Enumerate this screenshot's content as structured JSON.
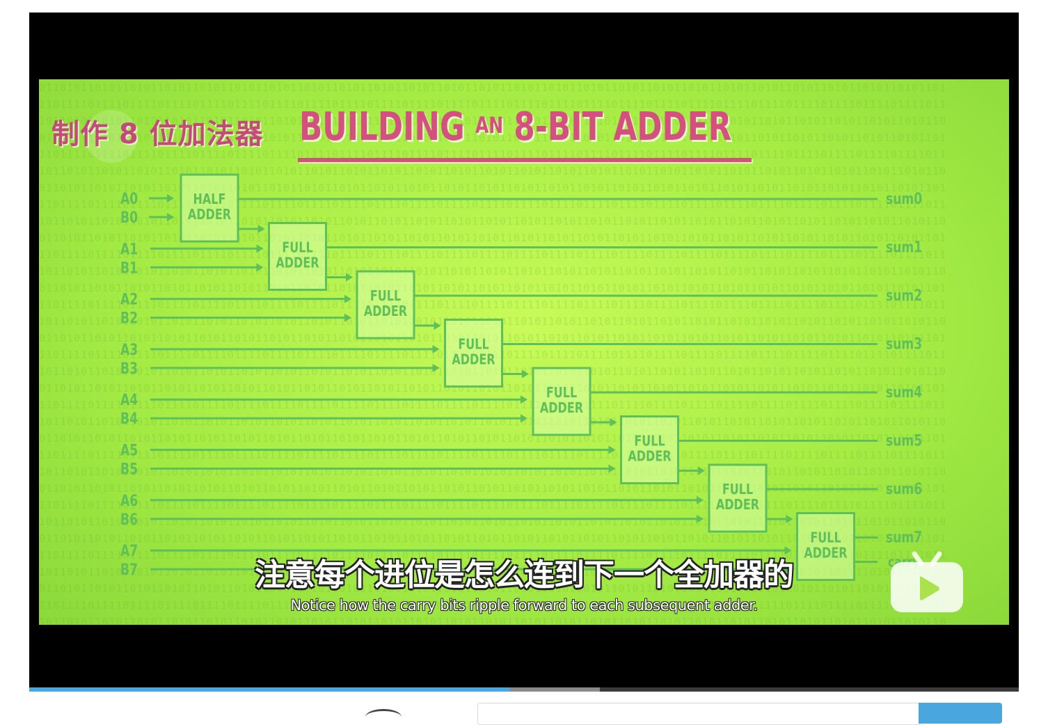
{
  "video": {
    "title_cn": "制作 8 位加法器",
    "title_en_main": "BUILDING",
    "title_en_small": "AN",
    "title_en_rest": "8-BIT ADDER",
    "subtitle_cn": "注意每个进位是怎么连到下一个全加器的",
    "subtitle_en": "Notice how the carry bits ripple forward to each subsequent adder."
  },
  "diagram": {
    "inputs": [
      {
        "a": "A0",
        "b": "B0"
      },
      {
        "a": "A1",
        "b": "B1"
      },
      {
        "a": "A2",
        "b": "B2"
      },
      {
        "a": "A3",
        "b": "B3"
      },
      {
        "a": "A4",
        "b": "B4"
      },
      {
        "a": "A5",
        "b": "B5"
      },
      {
        "a": "A6",
        "b": "B6"
      },
      {
        "a": "A7",
        "b": "B7"
      }
    ],
    "adders": [
      {
        "line1": "HALF",
        "line2": "ADDER"
      },
      {
        "line1": "FULL",
        "line2": "ADDER"
      },
      {
        "line1": "FULL",
        "line2": "ADDER"
      },
      {
        "line1": "FULL",
        "line2": "ADDER"
      },
      {
        "line1": "FULL",
        "line2": "ADDER"
      },
      {
        "line1": "FULL",
        "line2": "ADDER"
      },
      {
        "line1": "FULL",
        "line2": "ADDER"
      },
      {
        "line1": "FULL",
        "line2": "ADDER"
      }
    ],
    "sums": [
      "sum0",
      "sum1",
      "sum2",
      "sum3",
      "sum4",
      "sum5",
      "sum6",
      "sum7"
    ],
    "carry_label": "carry"
  },
  "player": {
    "progress": 0.485,
    "buffered": 0.577
  },
  "colors": {
    "accent": "#4aa7dd",
    "title_pink": "#d3507f",
    "diagram_green": "#5fbf5a",
    "background_green": "#b5f24f"
  },
  "icons": {
    "play": "play-tv-icon"
  }
}
